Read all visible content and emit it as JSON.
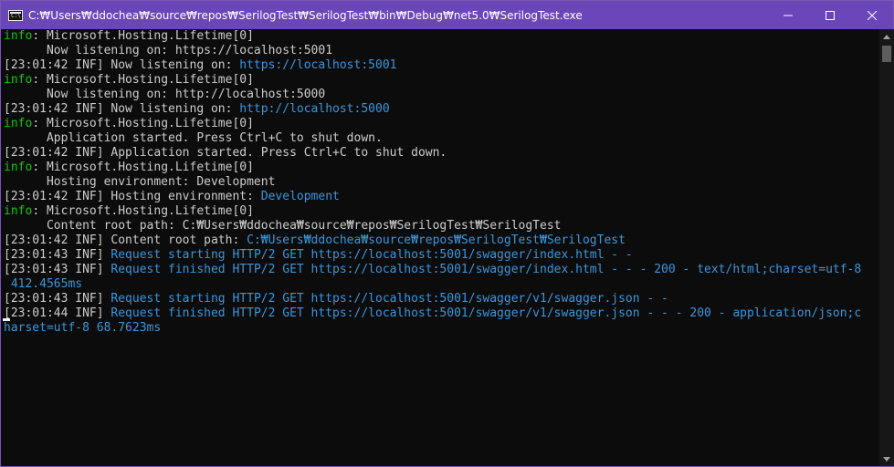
{
  "window": {
    "title": "C:₩Users₩ddochea₩source₩repos₩SerilogTest₩SerilogTest₩bin₩Debug₩net5.0₩SerilogTest.exe",
    "icon_glyph": "C:\\",
    "controls": [
      "minimize-icon",
      "maximize-icon",
      "close-icon"
    ]
  },
  "colors": {
    "titlebar": "#6b46b9",
    "background": "#0c0c0c",
    "text": "#cccccc",
    "info_label": "#16c60c",
    "highlight": "#3a96dd"
  },
  "console": {
    "lines": [
      [
        {
          "t": "info",
          "c": "green"
        },
        {
          "t": ": Microsoft.Hosting.Lifetime[0]",
          "c": "default"
        }
      ],
      [
        {
          "t": "      Now listening on: https://localhost:5001",
          "c": "default"
        }
      ],
      [
        {
          "t": "[23:01:42 INF] Now listening on: ",
          "c": "default"
        },
        {
          "t": "https://localhost:5001",
          "c": "cyan"
        }
      ],
      [
        {
          "t": "info",
          "c": "green"
        },
        {
          "t": ": Microsoft.Hosting.Lifetime[0]",
          "c": "default"
        }
      ],
      [
        {
          "t": "      Now listening on: http://localhost:5000",
          "c": "default"
        }
      ],
      [
        {
          "t": "[23:01:42 INF] Now listening on: ",
          "c": "default"
        },
        {
          "t": "http://localhost:5000",
          "c": "cyan"
        }
      ],
      [
        {
          "t": "info",
          "c": "green"
        },
        {
          "t": ": Microsoft.Hosting.Lifetime[0]",
          "c": "default"
        }
      ],
      [
        {
          "t": "      Application started. Press Ctrl+C to shut down.",
          "c": "default"
        }
      ],
      [
        {
          "t": "[23:01:42 INF] Application started. Press Ctrl+C to shut down.",
          "c": "default"
        }
      ],
      [
        {
          "t": "info",
          "c": "green"
        },
        {
          "t": ": Microsoft.Hosting.Lifetime[0]",
          "c": "default"
        }
      ],
      [
        {
          "t": "      Hosting environment: Development",
          "c": "default"
        }
      ],
      [
        {
          "t": "[23:01:42 INF] Hosting environment: ",
          "c": "default"
        },
        {
          "t": "Development",
          "c": "cyan"
        }
      ],
      [
        {
          "t": "info",
          "c": "green"
        },
        {
          "t": ": Microsoft.Hosting.Lifetime[0]",
          "c": "default"
        }
      ],
      [
        {
          "t": "      Content root path: C:₩Users₩ddochea₩source₩repos₩SerilogTest₩SerilogTest",
          "c": "default"
        }
      ],
      [
        {
          "t": "[23:01:42 INF] Content root path: ",
          "c": "default"
        },
        {
          "t": "C:₩Users₩ddochea₩source₩repos₩SerilogTest₩SerilogTest",
          "c": "cyan"
        }
      ],
      [
        {
          "t": "[23:01:43 INF] ",
          "c": "default"
        },
        {
          "t": "Request starting HTTP/2 GET https://localhost:5001/swagger/index.html - -",
          "c": "cyan"
        }
      ],
      [
        {
          "t": "[23:01:43 INF] ",
          "c": "default"
        },
        {
          "t": "Request finished HTTP/2 GET https://localhost:5001/swagger/index.html - - - 200 - text/html;charset=utf-8",
          "c": "cyan"
        }
      ],
      [
        {
          "t": " 412.4565ms",
          "c": "cyan"
        }
      ],
      [
        {
          "t": "[23:01:43 INF] ",
          "c": "default"
        },
        {
          "t": "Request starting HTTP/2 GET https://localhost:5001/swagger/v1/swagger.json - -",
          "c": "cyan"
        }
      ],
      [
        {
          "t": "[23:01:44 INF] ",
          "c": "default"
        },
        {
          "t": "Request finished HTTP/2 GET https://localhost:5001/swagger/v1/swagger.json - - - 200 - application/json;c",
          "c": "cyan"
        }
      ],
      [
        {
          "t": "harset=utf-8 68.7623ms",
          "c": "cyan"
        }
      ]
    ]
  }
}
